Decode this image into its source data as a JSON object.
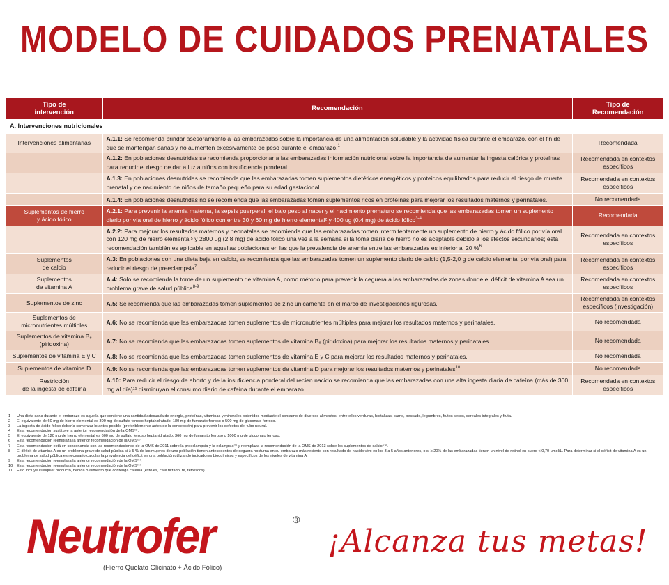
{
  "title": "MODELO DE CUIDADOS PRENATALES",
  "table": {
    "headers": {
      "type_l1": "Tipo de",
      "type_l2": "intervención",
      "rec": "Recomendación",
      "cat_l1": "Tipo de",
      "cat_l2": "Recomendación"
    },
    "section": "A. Intervenciones nutricionales",
    "rows": [
      {
        "type_l1": "Intervenciones alimentarias",
        "type_l2": "",
        "code": "A.1.1:",
        "text": "Se recomienda brindar asesoramiento a las embarazadas sobre la importancia de una alimentación saludable y la actividad física durante el embarazo, con el fin de que se mantengan sanas y no aumenten excesivamente de peso durante el embarazo.",
        "sup": "1",
        "cat_l1": "Recomendada",
        "cat_l2": ""
      },
      {
        "type_l1": "",
        "type_l2": "",
        "code": "A.1.2:",
        "text": "En poblaciones desnutridas se recomienda proporcionar a las embarazadas información nutricional sobre la importancia de aumentar la ingesta calórica y proteínas para reducir el riesgo de dar a luz a niños con insuficiencia ponderal.",
        "sup": "",
        "cat_l1": "Recomendada en contextos",
        "cat_l2": "específicos"
      },
      {
        "type_l1": "",
        "type_l2": "",
        "code": "A.1.3:",
        "text": "En poblaciones desnutridas se recomienda que las embarazadas tomen suplementos dietéticos energéticos y proteicos equilibrados para reducir el riesgo de muerte prenatal y de nacimiento de niños de tamaño pequeño para su edad gestacional.",
        "sup": "",
        "cat_l1": "Recomendada en contextos",
        "cat_l2": "específicos"
      },
      {
        "type_l1": "",
        "type_l2": "",
        "code": "A.1.4:",
        "text": "En poblaciones desnutridas no se recomienda que las embarazadas tomen suplementos ricos en proteínas para mejorar los resultados maternos y perinatales.",
        "sup": "",
        "cat_l1": "No recomendada",
        "cat_l2": ""
      },
      {
        "type_l1": "Suplementos de hierro",
        "type_l2": "y ácido fólico",
        "code": "A.2.1:",
        "text": "Para prevenir la anemia materna, la sepsis puerperal, el bajo peso al nacer y el nacimiento prematuro se recomienda que las embarazadas tomen un suplemento diario por vía oral de hierro y ácido fólico con entre 30 y 60 mg de hierro elemental² y 400 ug (0.4 mg) de ácido fólico",
        "sup": "3-4",
        "cat_l1": "Recomendada",
        "cat_l2": ""
      },
      {
        "type_l1": "",
        "type_l2": "",
        "code": "A.2.2:",
        "text": "Para mejorar los resultados maternos y neonatales se recomienda que las embarazadas tomen intermitentemente un suplemento de hierro y ácido fólico por vía oral con 120 mg de hierro elemental⁵ y 2800 μg (2.8 mg) de ácido fólico una vez a la semana si la toma diaria de hierro no es aceptable debido a los efectos secundarios; esta recomendación también es aplicable en aquellas poblaciones en las que la prevalencia de anemia entre las embarazadas es inferior al 20 %",
        "sup": "6",
        "cat_l1": "Recomendada en contextos",
        "cat_l2": "específicos"
      },
      {
        "type_l1": "Suplementos",
        "type_l2": "de calcio",
        "code": "A.3:",
        "text": "En poblaciones con una dieta baja en calcio, se recomienda que las embarazadas tomen un suplemento diario de calcio (1,5-2,0 g de calcio elemental por vía oral) para reducir el riesgo de preeclampsia",
        "sup": "7",
        "cat_l1": "Recomendada en contextos",
        "cat_l2": "específicos"
      },
      {
        "type_l1": "Suplementos",
        "type_l2": "de vitamina A",
        "code": "A.4:",
        "text": "Solo se recomienda la tome de un suplemento de vitamina A, como método para prevenir la ceguera a las embarazadas de zonas donde el déficit de vitamina A sea un problema grave de salud pública",
        "sup": "8-9",
        "cat_l1": "Recomendada en contextos",
        "cat_l2": "específicos"
      },
      {
        "type_l1": "Suplementos de zinc",
        "type_l2": "",
        "code": "A.5:",
        "text": "Se recomienda que las embarazadas tomen suplementos de zinc únicamente en el marco de investigaciones rigurosas.",
        "sup": "",
        "cat_l1": "Recomendada en contextos",
        "cat_l2": "específicos (investigación)"
      },
      {
        "type_l1": "Suplementos de",
        "type_l2": "micronutrientes múltiples",
        "code": "A.6:",
        "text": "No se recomienda que las embarazadas tomen suplementos de micronutrientes múltiples para mejorar los resultados maternos y perinatales.",
        "sup": "",
        "cat_l1": "No recomendada",
        "cat_l2": ""
      },
      {
        "type_l1": "Suplementos de vitamina B₆",
        "type_l2": "(piridoxina)",
        "code": "A.7:",
        "text": "No se recomienda que las embarazadas tomen suplementos de vitamina B₆ (piridoxina) para mejorar los resultados maternos y perinatales.",
        "sup": "",
        "cat_l1": "No recomendada",
        "cat_l2": ""
      },
      {
        "type_l1": "Suplementos de vitamina E y C",
        "type_l2": "",
        "code": "A.8:",
        "text": "No se recomienda que las embarazadas tomen suplementos de vitamina E y C para mejorar los resultados maternos y perinatales.",
        "sup": "",
        "cat_l1": "No recomendada",
        "cat_l2": ""
      },
      {
        "type_l1": "Suplementos de vitamina D",
        "type_l2": "",
        "code": "A.9:",
        "text": "No se recomienda que las embarazadas tomen suplementos de vitamina D para mejorar los resultados maternos y perinatales",
        "sup": "10",
        "cat_l1": "No recomendada",
        "cat_l2": ""
      },
      {
        "type_l1": "Restricción",
        "type_l2": "de la ingesta de cafeína",
        "code": "A.10:",
        "text": "Para reducir el riesgo de aborto y de la insuficiencia ponderal del recien nacido se recomienda que las embarazadas con una alta ingesta diaria de cafeína (más de 300 mg al día)¹¹ disminuyan el consumo diario de cafeína durante el embarazo.",
        "sup": "",
        "cat_l1": "Recomendada en contextos",
        "cat_l2": "específicos"
      }
    ]
  },
  "footnotes": [
    {
      "n": "1",
      "t": "Una dieta sana durante el embarazo es aquella que contiene una cantidad adecuada de energía, proteínas, vitaminas y minerales obtenidos mediante el consumo de diversos alimentos, entre ellos verduras, hortalizas, carne, pescado, legumbres, frutos secos, cereales integrales y fruta."
    },
    {
      "n": "2",
      "t": "El equivalente de 60 mg de hierro elemental es 300 mg de sulfato ferroso heptahidratado, 180 mg de fumarato ferroso o 500 mg de gluconato ferroso."
    },
    {
      "n": "3",
      "t": "La ingesta de ácido fólico debería comenzar lo antes posible (preferiblemente antes de la concepción) para prevenir los defectos del tubo neural."
    },
    {
      "n": "4",
      "t": "Esta recomendación sustituye la anterior recomendación de la OMS⁽¹⁾."
    },
    {
      "n": "5",
      "t": "El equivalente de 120 mg de hierro elemental es 600 mg de sulfato ferroso heptahidratado, 360 mg de fumarato ferroso o 1000 mg de gluconato ferroso."
    },
    {
      "n": "6",
      "t": "Esta recomendación reemplaza la anterior recomendación de la OMS⁽²⁾."
    },
    {
      "n": "7",
      "t": "Esta recomendación está en consonancia con las recomendaciones de la OMS de 2011 sobre la preeclampsia y la eclampsia⁽³⁾ y reemplaza la recomendación de la OMS de 2013 sobre los suplementos de calcio ⁽⁴⁾."
    },
    {
      "n": "8",
      "t": "El déficit de vitamina A es un problema grave de salud pública si ≥ 5 % de las mujeres de una población tienen antecedentes de ceguera nocturna en su embarazo más reciente con resultado de nacido vivo en los 3 a 5 años anteriores, o si ≥ 20% de las embarazadas tienen un nivel de retinol en suero < 0,70 μmol/L. Para determinar si el déficit de vitamina A es un problema de salud pública es necesario calcular la prevalencia del déficit en una población utilizando indicadores bioquímicos y específicos de los niveles de vitamina A."
    },
    {
      "n": "9",
      "t": "Esta recomendación reemplaza la anterior recomendación de la OMS⁽⁵⁾."
    },
    {
      "n": "10",
      "t": "Esta recomendación reemplaza la anterior recomendación de la OMS⁽⁶⁾."
    },
    {
      "n": "11",
      "t": "Esto incluye cualquier producto, bebida o alimento que contenga cafeína (esto es, café  filtrado, té, refrescos)."
    }
  ],
  "brand": {
    "name": "Neutrofer",
    "registered": "®",
    "subtitle": "(Hierro Quelato Glicinato + Ácido Fólico)",
    "tagline": "¡Alcanza tus metas!"
  },
  "colors": {
    "title_red": "#b5161c",
    "header_red": "#a8171e",
    "row_light": "#f3dfd3",
    "row_dark": "#ecd0c0",
    "row_highlight": "#bf4a3c"
  }
}
